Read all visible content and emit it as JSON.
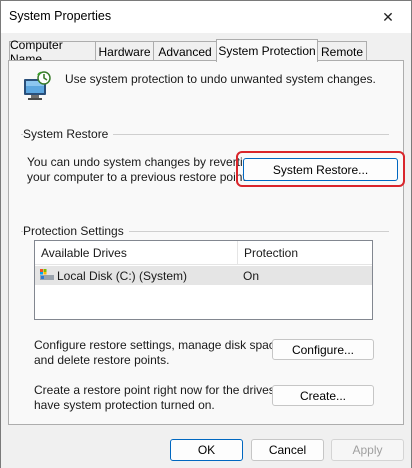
{
  "window": {
    "title": "System Properties",
    "close_glyph": "✕"
  },
  "tabs": [
    {
      "label": "Computer Name"
    },
    {
      "label": "Hardware"
    },
    {
      "label": "Advanced"
    },
    {
      "label": "System Protection",
      "active": true
    },
    {
      "label": "Remote"
    }
  ],
  "intro": {
    "icon": "system-protection-icon",
    "text": "Use system protection to undo unwanted system changes."
  },
  "system_restore": {
    "group_title": "System Restore",
    "description_line1": "You can undo system changes by reverting",
    "description_line2": "your computer to a previous restore point.",
    "button_label": "System Restore...",
    "highlight_color": "#d9252b"
  },
  "protection_settings": {
    "group_title": "Protection Settings",
    "columns": [
      "Available Drives",
      "Protection"
    ],
    "drives": [
      {
        "name": "Local Disk (C:) (System)",
        "protection": "On",
        "icon": "drive-icon"
      }
    ],
    "configure": {
      "description_line1": "Configure restore settings, manage disk space,",
      "description_line2": "and delete restore points.",
      "button_label": "Configure..."
    },
    "create": {
      "description_line1": "Create a restore point right now for the drives that",
      "description_line2": "have system protection turned on.",
      "button_label": "Create..."
    }
  },
  "footer": {
    "ok_label": "OK",
    "cancel_label": "Cancel",
    "apply_label": "Apply"
  },
  "colors": {
    "accent": "#0067c0",
    "highlight_ring": "#d9252b",
    "selected_row": "#e5e5e5"
  }
}
